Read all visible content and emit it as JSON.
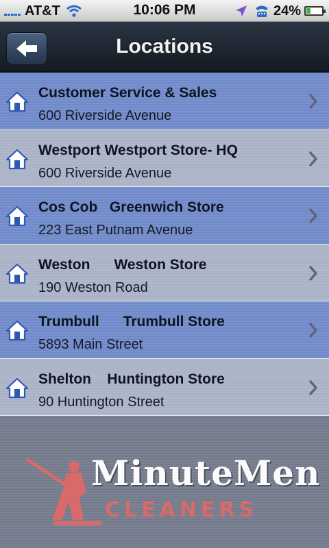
{
  "status_bar": {
    "carrier": "AT&T",
    "time": "10:06 PM",
    "battery_percent": "24%",
    "battery_level": 0.24
  },
  "nav": {
    "title": "Locations",
    "back_icon": "back-arrow-icon"
  },
  "locations": [
    {
      "title": "Customer Service & Sales",
      "address": "600 Riverside Avenue",
      "style": "blue"
    },
    {
      "title": "Westport Westport Store- HQ",
      "address": "600 Riverside Avenue",
      "style": "gray"
    },
    {
      "title": "Cos Cob   Greenwich Store",
      "address": "223 East Putnam Avenue",
      "style": "blue"
    },
    {
      "title": "Weston      Weston Store",
      "address": "190 Weston Road",
      "style": "gray"
    },
    {
      "title": "Trumbull      Trumbull Store",
      "address": "5893 Main Street",
      "style": "blue"
    },
    {
      "title": "Shelton    Huntington Store",
      "address": "90 Huntington Street",
      "style": "gray"
    }
  ],
  "footer": {
    "logo_line1": "MinuteMen",
    "logo_line2": "CLEANERS"
  },
  "colors": {
    "row_blue": "#6f89c9",
    "row_gray": "#a9b2c6",
    "nav_bg": "#1d2530",
    "logo_red": "#d86a6a"
  }
}
